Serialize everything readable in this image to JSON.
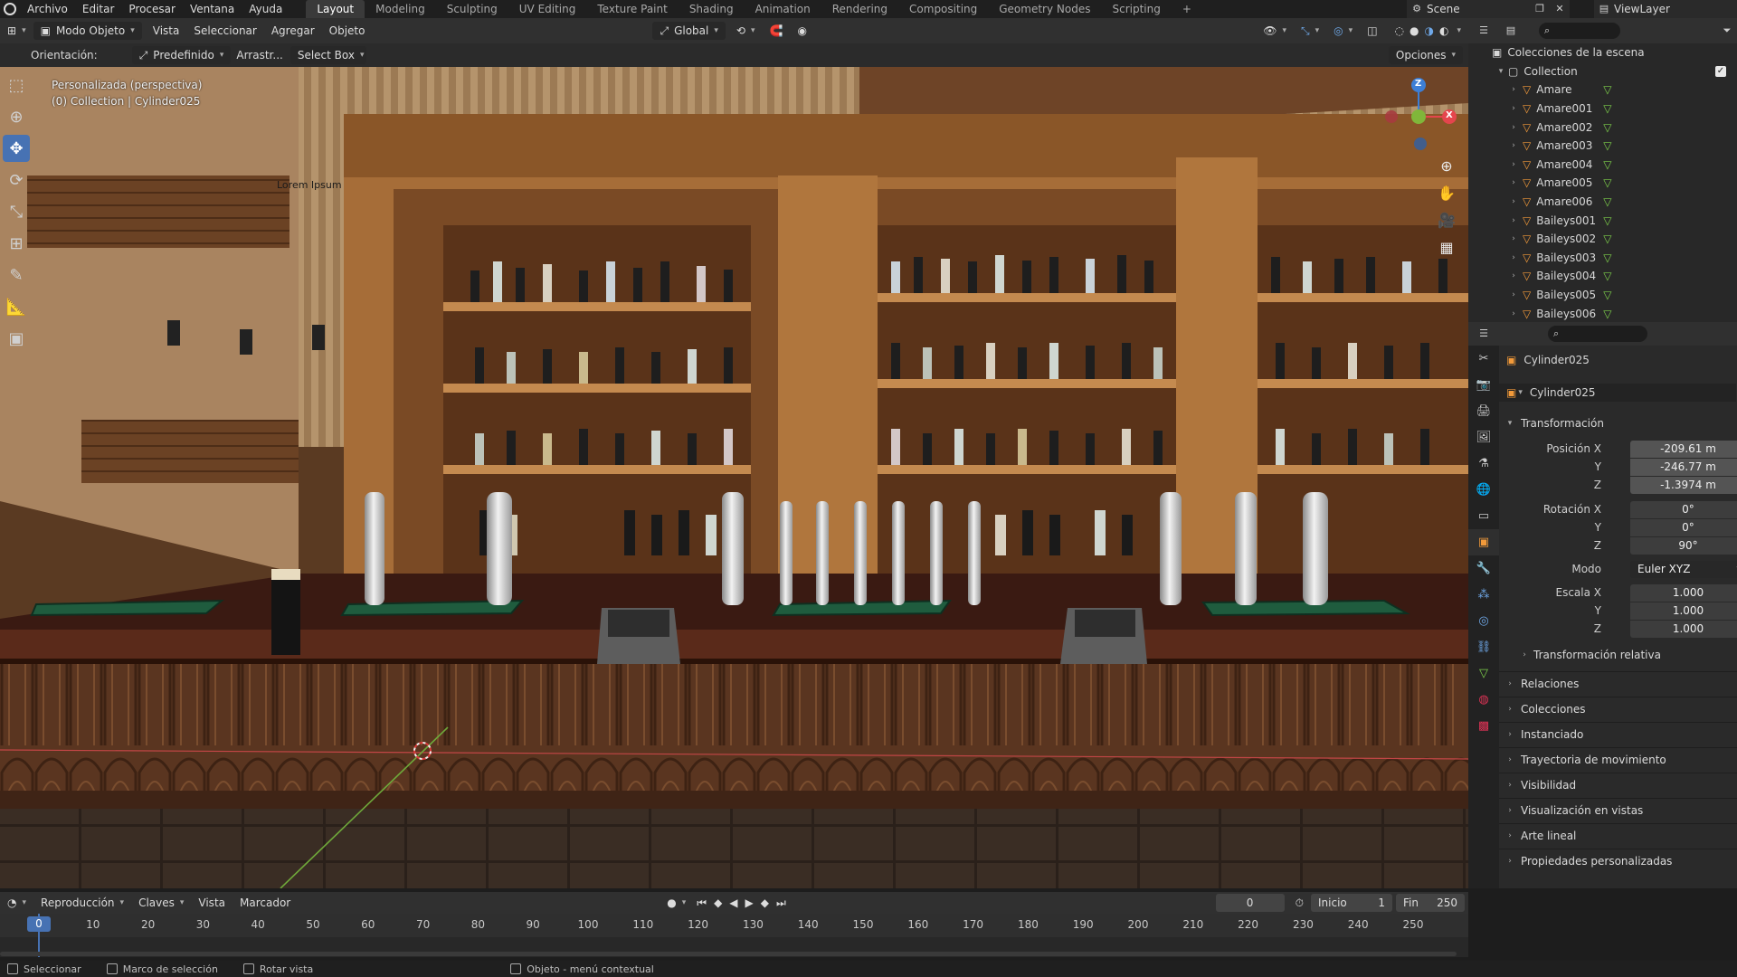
{
  "menu": {
    "items": [
      "Archivo",
      "Editar",
      "Procesar",
      "Ventana",
      "Ayuda"
    ],
    "workspaces": [
      "Layout",
      "Modeling",
      "Sculpting",
      "UV Editing",
      "Texture Paint",
      "Shading",
      "Animation",
      "Rendering",
      "Compositing",
      "Geometry Nodes",
      "Scripting"
    ],
    "active_workspace": "Layout",
    "add_tab": "+",
    "scene": "Scene",
    "view_layer": "ViewLayer"
  },
  "viewport_header": {
    "mode": "Modo Objeto",
    "menus": [
      "Vista",
      "Seleccionar",
      "Agregar",
      "Objeto"
    ],
    "transform_orientation": "Global"
  },
  "tool_settings": {
    "orientation_label": "Orientación:",
    "orientation_value": "Predefinido",
    "drag_label": "Arrastr...",
    "drag_value": "Select Box",
    "options": "Opciones"
  },
  "viewport": {
    "view_name": "Personalizada (perspectiva)",
    "collection_info": "(0) Collection | Cylinder025",
    "lorem_sign": "Lorem Ipsum",
    "gizmo_axes": {
      "z": "Z",
      "x": "X"
    },
    "colors": {
      "x_axis": "#e5454d",
      "y_axis": "#80b63a",
      "z_axis": "#3d7fd6"
    }
  },
  "outliner": {
    "title": "Colecciones de la escena",
    "collection": "Collection",
    "items": [
      "Amare",
      "Amare001",
      "Amare002",
      "Amare003",
      "Amare004",
      "Amare005",
      "Amare006",
      "Baileys001",
      "Baileys002",
      "Baileys003",
      "Baileys004",
      "Baileys005",
      "Baileys006"
    ]
  },
  "properties": {
    "object_name": "Cylinder025",
    "data_name": "Cylinder025",
    "transform_section": "Transformación",
    "location_label": "Posición X",
    "rotation_label": "Rotación X",
    "scale_label": "Escala X",
    "axis_y": "Y",
    "axis_z": "Z",
    "location": [
      "-209.61 m",
      "-246.77 m",
      "-1.3974 m"
    ],
    "rotation": [
      "0°",
      "0°",
      "90°"
    ],
    "mode_label": "Modo",
    "mode_value": "Euler XYZ",
    "scale": [
      "1.000",
      "1.000",
      "1.000"
    ],
    "delta_section": "Transformación relativa",
    "sections": [
      "Relaciones",
      "Colecciones",
      "Instanciado",
      "Trayectoria de movimiento",
      "Visibilidad",
      "Visualización en vistas",
      "Arte lineal",
      "Propiedades personalizadas"
    ]
  },
  "timeline": {
    "menus": [
      "Reproducción",
      "Claves",
      "Vista",
      "Marcador"
    ],
    "current_frame": "0",
    "start_label": "Inicio",
    "start": "1",
    "end_label": "Fin",
    "end": "250",
    "ticks": [
      "0",
      "10",
      "20",
      "30",
      "40",
      "50",
      "60",
      "70",
      "80",
      "90",
      "100",
      "110",
      "120",
      "130",
      "140",
      "150",
      "160",
      "170",
      "180",
      "190",
      "200",
      "210",
      "220",
      "230",
      "240",
      "250"
    ]
  },
  "status_bar": {
    "items": [
      "Seleccionar",
      "Marco de selección",
      "Rotar vista",
      "Objeto - menú contextual"
    ]
  }
}
